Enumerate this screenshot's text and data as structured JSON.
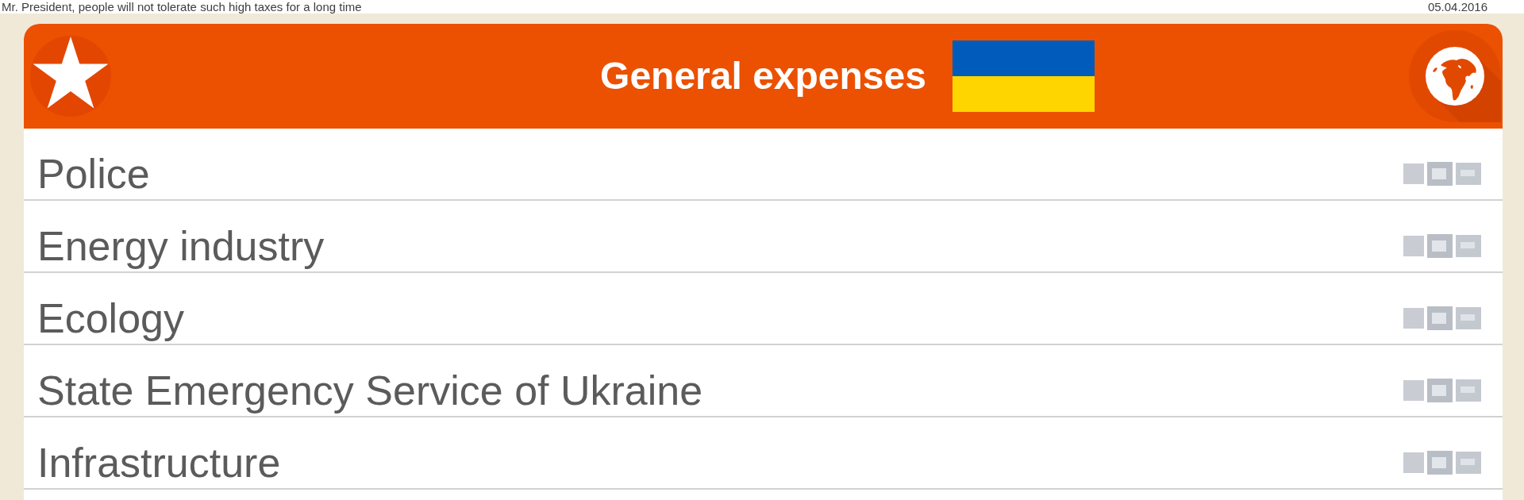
{
  "ticker": {
    "text": "Mr. President, people will not tolerate such high taxes for a long time",
    "date": "05.04.2016"
  },
  "header": {
    "title": "General expenses"
  },
  "expenses": [
    {
      "label": "Police"
    },
    {
      "label": "Energy industry"
    },
    {
      "label": "Ecology"
    },
    {
      "label": "State Emergency Service of Ukraine"
    },
    {
      "label": "Infrastructure"
    }
  ]
}
